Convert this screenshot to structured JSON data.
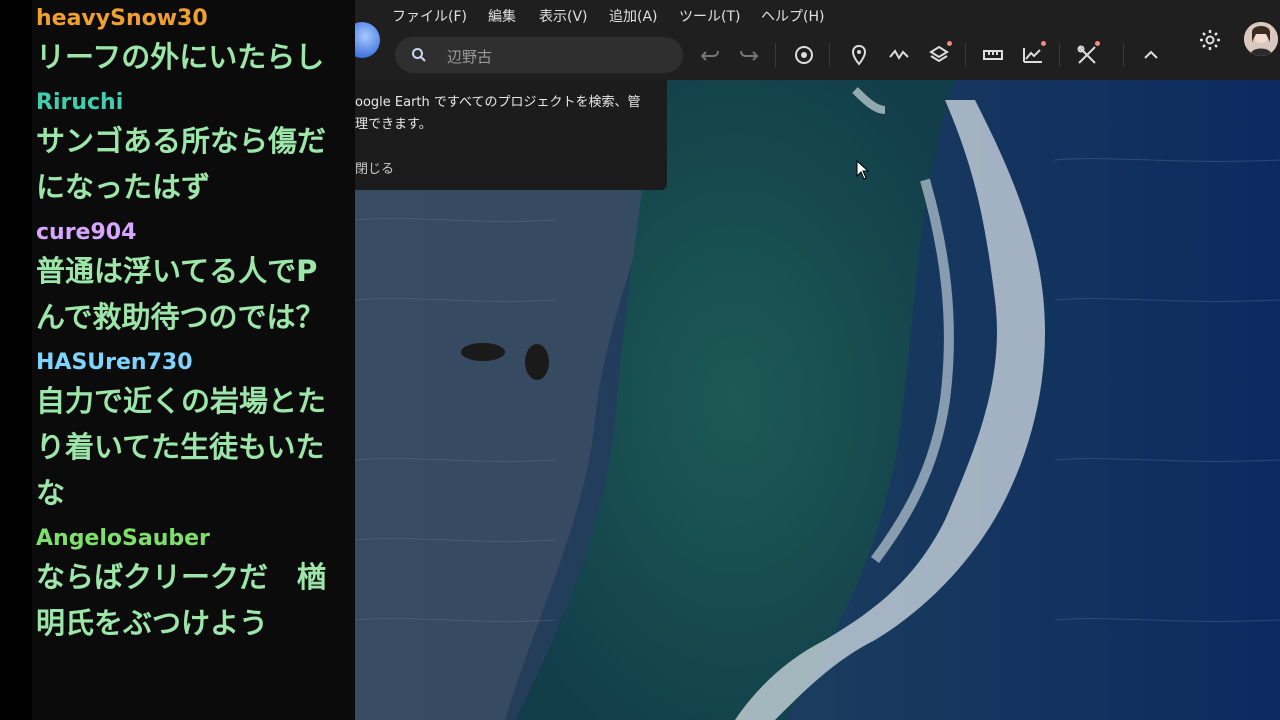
{
  "chat": {
    "messages": [
      {
        "user": "heavySnow30",
        "user_color": "#f0a030",
        "text": "リーフの外にいたらし"
      },
      {
        "user": "Riruchi",
        "user_color": "#3ecfb0",
        "text": "サンゴある所なら傷だ\nになったはず"
      },
      {
        "user": "cure904",
        "user_color": "#d7a6ff",
        "text": "普通は浮いてる人でP\nんで救助待つのでは？"
      },
      {
        "user": "HASUren730",
        "user_color": "#7fd4ff",
        "text": "自力で近くの岩場とた\nり着いてた生徒もいた\nな"
      },
      {
        "user": "AngeloSauber",
        "user_color": "#7ee06a",
        "text": "ならばクリークだ　楢\n明氏をぶつけよう"
      }
    ]
  },
  "menu": {
    "items": [
      "ファイル(F)",
      "編集",
      "表示(V)",
      "追加(A)",
      "ツール(T)",
      "ヘルプ(H)"
    ]
  },
  "search": {
    "value": "辺野古"
  },
  "toolbar": {
    "icons": [
      "undo-icon",
      "redo-icon",
      "history-icon",
      "pin-icon",
      "path-icon",
      "layers-icon",
      "ruler-icon",
      "chart-icon",
      "tools-icon",
      "collapse-icon"
    ],
    "notification_color": "#f28b82"
  },
  "panel": {
    "text": "oogle Earth ですべてのプロジェクトを検索、管\n理できます。",
    "close_label": "閉じる"
  },
  "colors": {
    "bar_bg": "#1f1f1f",
    "chat_text": "#9be6a8"
  }
}
